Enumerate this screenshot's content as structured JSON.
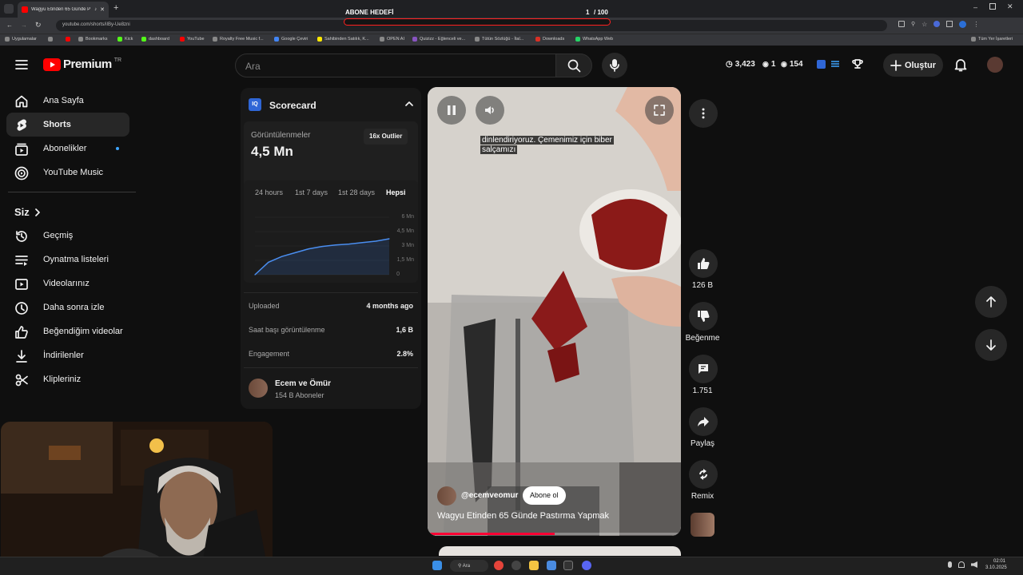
{
  "browser": {
    "tab_title": "Wagyu Etinden 65 Günde P",
    "url": "youtube.com/shorts/iIBy-Ue8zni",
    "bookmarks": [
      "Uygulamalar",
      "Bookmarks",
      "Kick",
      "dashboard",
      "YouTube",
      "Royalty Free Music f...",
      "Google Çeviri",
      "Sahibinden Satılık, K...",
      "OPEN AI",
      "Quizizz - Eğlenceli ve...",
      "Tütün Sözlüğü - İtal...",
      "Downloads",
      "WhatsApp Web"
    ],
    "all_bookmarks": "Tüm Yer İşaretleri"
  },
  "goal": {
    "label": "ABONE HEDEFİ",
    "count": "1",
    "sep_total": "/ 100"
  },
  "header": {
    "logo": "Premium",
    "region": "TR",
    "search_placeholder": "Ara",
    "stat1": "3,423",
    "stat2": "1",
    "stat3": "154",
    "create_label": "Oluştur"
  },
  "sidebar": {
    "items": [
      {
        "label": "Ana Sayfa",
        "icon": "home-icon"
      },
      {
        "label": "Shorts",
        "icon": "shorts-icon"
      },
      {
        "label": "Abonelikler",
        "icon": "subscriptions-icon"
      },
      {
        "label": "YouTube Music",
        "icon": "youtube-music-icon"
      }
    ],
    "you_label": "Siz",
    "you_items": [
      {
        "label": "Geçmiş",
        "icon": "history-icon"
      },
      {
        "label": "Oynatma listeleri",
        "icon": "playlists-icon"
      },
      {
        "label": "Videolarınız",
        "icon": "your-videos-icon"
      },
      {
        "label": "Daha sonra izle",
        "icon": "watch-later-icon"
      },
      {
        "label": "Beğendiğim videolar",
        "icon": "liked-videos-icon"
      },
      {
        "label": "İndirilenler",
        "icon": "downloads-icon"
      },
      {
        "label": "Klipleriniz",
        "icon": "clips-icon"
      }
    ]
  },
  "scorecard": {
    "title": "Scorecard",
    "views_label": "Görüntülenmeler",
    "views_value": "4,5 Mn",
    "outlier_badge": "16x Outlier",
    "ranges": [
      "24 hours",
      "1st 7 days",
      "1st 28 days",
      "Hepsi"
    ],
    "selected_range": "Hepsi",
    "y_ticks": [
      "6 Mn",
      "4,5 Mn",
      "3 Mn",
      "1,5 Mn",
      "0"
    ],
    "rows": [
      {
        "label": "Uploaded",
        "value": "4 months ago"
      },
      {
        "label": "Saat başı görüntülenme",
        "value": "1,6 B"
      },
      {
        "label": "Engagement",
        "value": "2.8%"
      }
    ],
    "channel_name": "Ecem ve Ömür",
    "channel_subs": "154 B Aboneler"
  },
  "chart_data": {
    "type": "area",
    "title": "",
    "xlabel": "",
    "ylabel": "",
    "ylim": [
      0,
      6
    ],
    "x": [
      0,
      1,
      2,
      3,
      4,
      5,
      6,
      7,
      8,
      9,
      10
    ],
    "series": [
      {
        "values": [
          0,
          1.3,
          1.9,
          2.3,
          2.7,
          2.95,
          3.1,
          3.2,
          3.35,
          3.5,
          3.75
        ]
      }
    ]
  },
  "video": {
    "caption": "dinlendiriyoruz. Çemenimiz için biber salçamızı",
    "channel_handle": "@ecemveomur",
    "subscribe_label": "Abone ol",
    "title": "Wagyu Etinden 65 Günde Pastırma Yapmak",
    "progress": 0.5
  },
  "actions": {
    "likes": "126 B",
    "dislike_label": "Beğenme",
    "comments": "1.751",
    "share_label": "Paylaş",
    "remix_label": "Remix"
  },
  "taskbar": {
    "search_label": "Ara",
    "time": "02:01",
    "date": "3.10.2025"
  },
  "colors": {
    "brand_red": "#ff0000",
    "accent_blue": "#3ea6ff",
    "bg": "#0f0f0f"
  }
}
